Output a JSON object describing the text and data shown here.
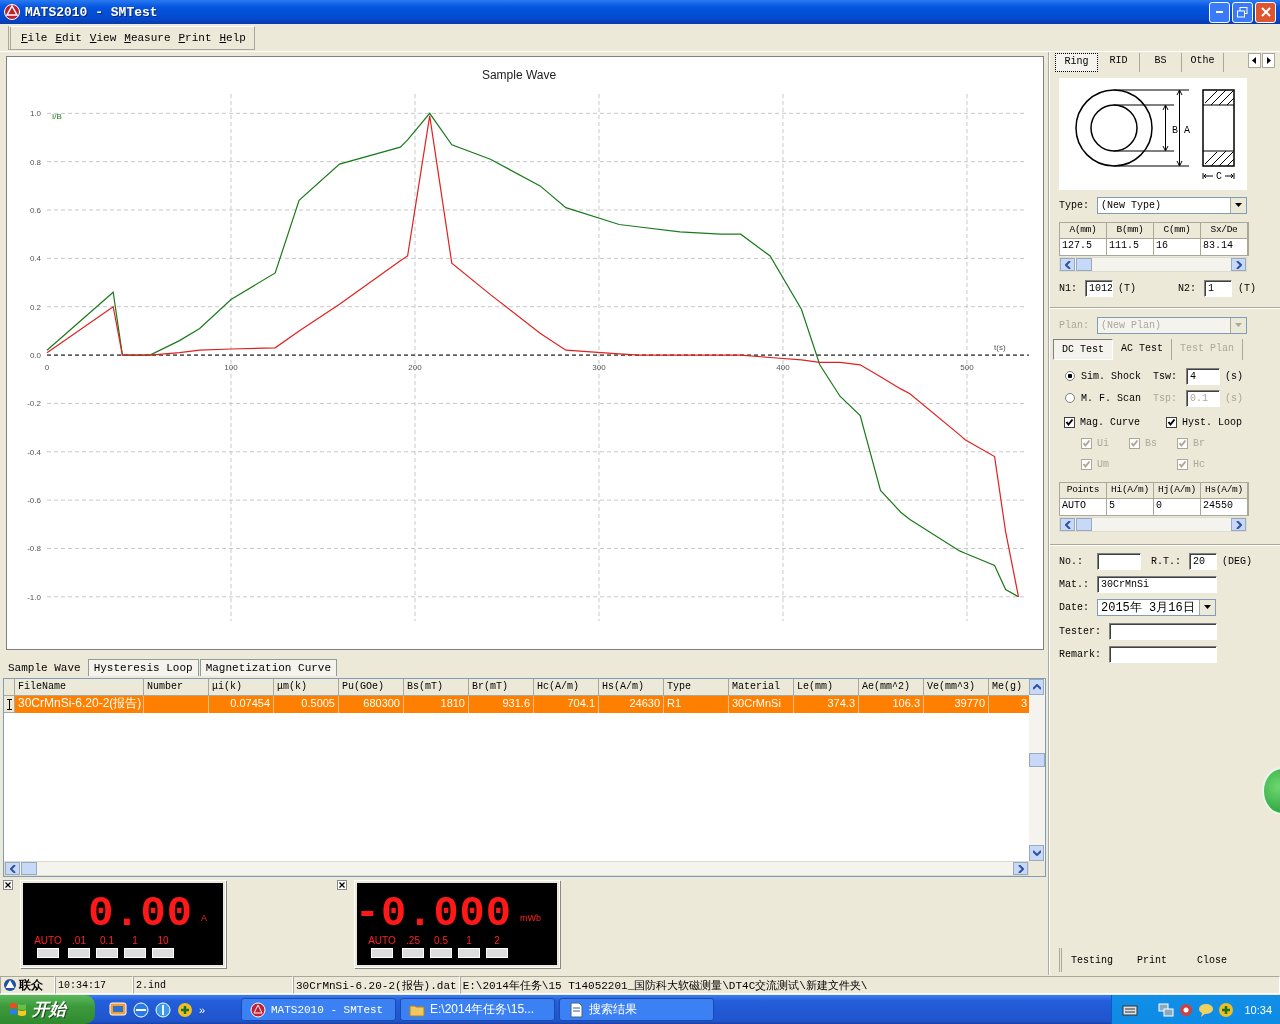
{
  "window": {
    "title": "MATS2010 - SMTest"
  },
  "menu": [
    "File",
    "Edit",
    "View",
    "Measure",
    "Print",
    "Help"
  ],
  "chart_panel": {
    "chart_data": {
      "type": "line",
      "title": "Sample Wave",
      "xlabel": "t(s)",
      "ylabel": "I/B",
      "grid": true,
      "x": [
        0,
        36,
        41,
        56,
        72,
        83,
        100,
        124,
        137,
        159,
        192,
        196,
        208,
        220,
        241,
        268,
        282,
        311,
        322,
        344,
        366,
        377,
        393,
        410,
        420,
        431,
        442,
        453,
        464,
        469,
        496,
        499,
        515,
        521,
        528
      ],
      "series": [
        {
          "color": "#1a7a1a",
          "values": [
            0.02,
            0.26,
            0,
            0,
            0.06,
            0.11,
            0.23,
            0.34,
            0.64,
            0.79,
            0.86,
            0.89,
            1.0,
            0.87,
            0.81,
            0.7,
            0.61,
            0.54,
            0.53,
            0.51,
            0.5,
            0.5,
            0.41,
            0.19,
            -0.04,
            -0.17,
            -0.25,
            -0.56,
            -0.65,
            -0.68,
            -0.81,
            -0.82,
            -0.87,
            -0.97,
            -1.0
          ]
        },
        {
          "color": "#e02020",
          "values": [
            0.01,
            0.2,
            0,
            0,
            0.01,
            0.02,
            0.025,
            0.03,
            0.1,
            0.21,
            0.39,
            0.41,
            0.99,
            0.38,
            0.25,
            0.09,
            0.02,
            0.005,
            0,
            0,
            0,
            0,
            -0.01,
            -0.02,
            -0.03,
            -0.03,
            -0.04,
            -0.09,
            -0.14,
            -0.16,
            -0.33,
            -0.35,
            -0.42,
            -0.73,
            -1.0
          ]
        }
      ],
      "ref_lines": [
        {
          "axis": "y",
          "value": 0,
          "color": "#000000"
        }
      ],
      "xlim": [
        0,
        531
      ],
      "ylim": [
        -1.1,
        1.08
      ],
      "xticks": [
        0,
        100,
        200,
        300,
        400,
        500
      ],
      "yticks": [
        {
          "value": 1,
          "label": "1.0"
        },
        0.8,
        0.6,
        0.4,
        0.2,
        {
          "value": 0,
          "label": "0.0"
        },
        -0.2,
        -0.4,
        -0.6,
        -0.8,
        {
          "value": -1,
          "label": "-1.0"
        }
      ]
    }
  },
  "view_tabs": [
    {
      "label": "Sample Wave",
      "selected": true
    },
    {
      "label": "Hysteresis Loop",
      "selected": false
    },
    {
      "label": "Magnetization Curve",
      "selected": false
    }
  ],
  "results_table": {
    "columns": [
      "FileName",
      "Number",
      "μi(k)",
      "μm(k)",
      "Pu(GOe)",
      "Bs(mT)",
      "Br(mT)",
      "Hc(A/m)",
      "Hs(A/m)",
      "Type",
      "Material",
      "Le(mm)",
      "Ae(mm^2)",
      "Ve(mm^3)",
      "Me(g)"
    ],
    "rows": [
      {
        "selected": true,
        "cells": [
          "30CrMnSi-6.20-2(报告)",
          null,
          "0.07454",
          "0.5005",
          "680300",
          "1810",
          "931.6",
          "704.1",
          "24630",
          "R1",
          "30CrMnSi",
          "374.3",
          "106.3",
          "39770",
          "3"
        ]
      }
    ]
  },
  "meters": [
    {
      "reading": "0.00",
      "unit": "A",
      "ranges": [
        "AUTO",
        ".01",
        "0.1",
        "1",
        "10"
      ]
    },
    {
      "reading": "-0.000",
      "unit": "mWb",
      "ranges": [
        "AUTO",
        ".25",
        "0.5",
        "1",
        "2"
      ]
    }
  ],
  "side_panel": {
    "sample_tabs": [
      {
        "label": "Ring",
        "selected": true
      },
      {
        "label": "RID",
        "selected": false
      },
      {
        "label": "BS",
        "selected": false
      },
      {
        "label": "Othe",
        "selected": false
      }
    ],
    "diagram_labels": [
      "B",
      "A",
      "C"
    ],
    "type": {
      "label": "Type:",
      "value": "(New Type)"
    },
    "dimensions": {
      "columns": [
        "A(mm)",
        "B(mm)",
        "C(mm)",
        "Sx/De"
      ],
      "values": [
        "127.5",
        "111.5",
        "16",
        "83.14"
      ]
    },
    "turns": [
      {
        "label": "N1:",
        "value": "1012",
        "unit": "(T)"
      },
      {
        "label": "N2:",
        "value": "1",
        "unit": "(T)"
      }
    ],
    "plan": {
      "label": "Plan:",
      "value": "(New Plan)",
      "disabled": true
    },
    "test_tabs": [
      {
        "label": "DC Test",
        "selected": true,
        "disabled": false
      },
      {
        "label": "AC Test",
        "selected": false,
        "disabled": false
      },
      {
        "label": "Test Plan",
        "selected": false,
        "disabled": true
      }
    ],
    "modes": [
      {
        "label": "Sim. Shock",
        "selected": true,
        "param": "Tsw:",
        "value": "4",
        "unit": "(s)",
        "disabled": false
      },
      {
        "label": "M. F. Scan",
        "selected": false,
        "param": "Tsp:",
        "value": "0.1",
        "unit": "(s)",
        "disabled": true
      }
    ],
    "curves": [
      {
        "label": "Mag. Curve",
        "checked": true
      },
      {
        "label": "Hyst. Loop",
        "checked": true
      }
    ],
    "params": [
      {
        "items": [
          {
            "label": "Ui",
            "checked": true,
            "disabled": true
          },
          {
            "label": "Bs",
            "checked": true,
            "disabled": true
          },
          {
            "label": "Br",
            "checked": true,
            "disabled": true
          }
        ]
      },
      {
        "items": [
          {
            "label": "Um",
            "checked": true,
            "disabled": true
          },
          {
            "label": "Hc",
            "checked": true,
            "disabled": true
          }
        ]
      }
    ],
    "points_table": {
      "columns": [
        "Points",
        "Hi(A/m)",
        "Hj(A/m)",
        "Hs(A/m)"
      ],
      "values": [
        "AUTO",
        "5",
        "0",
        "24550"
      ]
    },
    "sample_info": {
      "number": {
        "label": "No.:"
      },
      "room_temp": {
        "label": "R.T.:",
        "value": "20",
        "unit": "(DEG)"
      },
      "material": {
        "label": "Mat.:",
        "value": "30CrMnSi"
      },
      "date": {
        "label": "Date:",
        "value": "2015年 3月16日"
      },
      "tester": {
        "label": "Tester:"
      },
      "remark": {
        "label": "Remark:"
      }
    },
    "actions": [
      "Testing",
      "Print",
      "Close"
    ]
  },
  "status_bar": {
    "brand": "联众",
    "cells": [
      "10:34:17",
      "2.ind",
      "30CrMnSi-6.20-2(报告).dat",
      "E:\\2014年任务\\15 T14052201_国防科大软磁测量\\DT4C交流测试\\新建文件夹\\"
    ]
  },
  "taskbar": {
    "start": "开始",
    "overflow": "»",
    "tasks": [
      "MATS2010 - SMTest",
      "E:\\2014年任务\\15...",
      "搜索结果"
    ],
    "clock": "10:34"
  }
}
